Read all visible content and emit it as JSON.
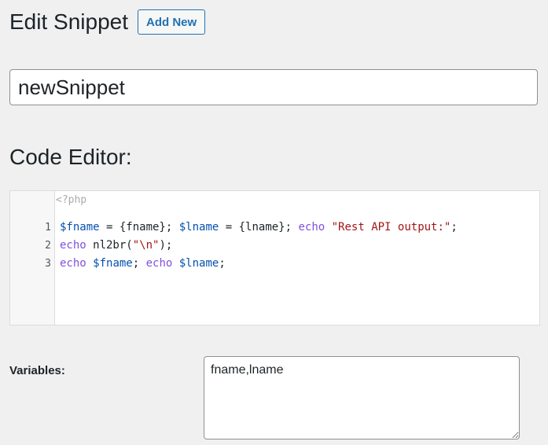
{
  "header": {
    "title": "Edit Snippet",
    "add_new_label": "Add New"
  },
  "snippet": {
    "title_value": "newSnippet"
  },
  "editor": {
    "heading": "Code Editor:",
    "php_open": "<?php",
    "lines": [
      {
        "number": "1",
        "tokens": [
          {
            "type": "var",
            "text": "$fname"
          },
          {
            "type": "plain",
            "text": " = {fname}; "
          },
          {
            "type": "var",
            "text": "$lname"
          },
          {
            "type": "plain",
            "text": " = {lname}; "
          },
          {
            "type": "kw",
            "text": "echo"
          },
          {
            "type": "plain",
            "text": " "
          },
          {
            "type": "str",
            "text": "\"Rest API output:\""
          },
          {
            "type": "plain",
            "text": ";"
          }
        ]
      },
      {
        "number": "2",
        "tokens": [
          {
            "type": "kw",
            "text": "echo"
          },
          {
            "type": "plain",
            "text": " nl2br("
          },
          {
            "type": "str",
            "text": "\"\\n\""
          },
          {
            "type": "plain",
            "text": ");"
          }
        ]
      },
      {
        "number": "3",
        "tokens": [
          {
            "type": "kw",
            "text": "echo"
          },
          {
            "type": "plain",
            "text": " "
          },
          {
            "type": "var",
            "text": "$fname"
          },
          {
            "type": "plain",
            "text": "; "
          },
          {
            "type": "kw",
            "text": "echo"
          },
          {
            "type": "plain",
            "text": " "
          },
          {
            "type": "var",
            "text": "$lname"
          },
          {
            "type": "plain",
            "text": ";"
          }
        ]
      }
    ]
  },
  "variables": {
    "label": "Variables:",
    "value": "fname,lname"
  },
  "colors": {
    "accent": "#2271b1",
    "background": "#f0f0f1",
    "variable_token": "#0550ae",
    "keyword_token": "#8250df",
    "string_token": "#a31515"
  }
}
